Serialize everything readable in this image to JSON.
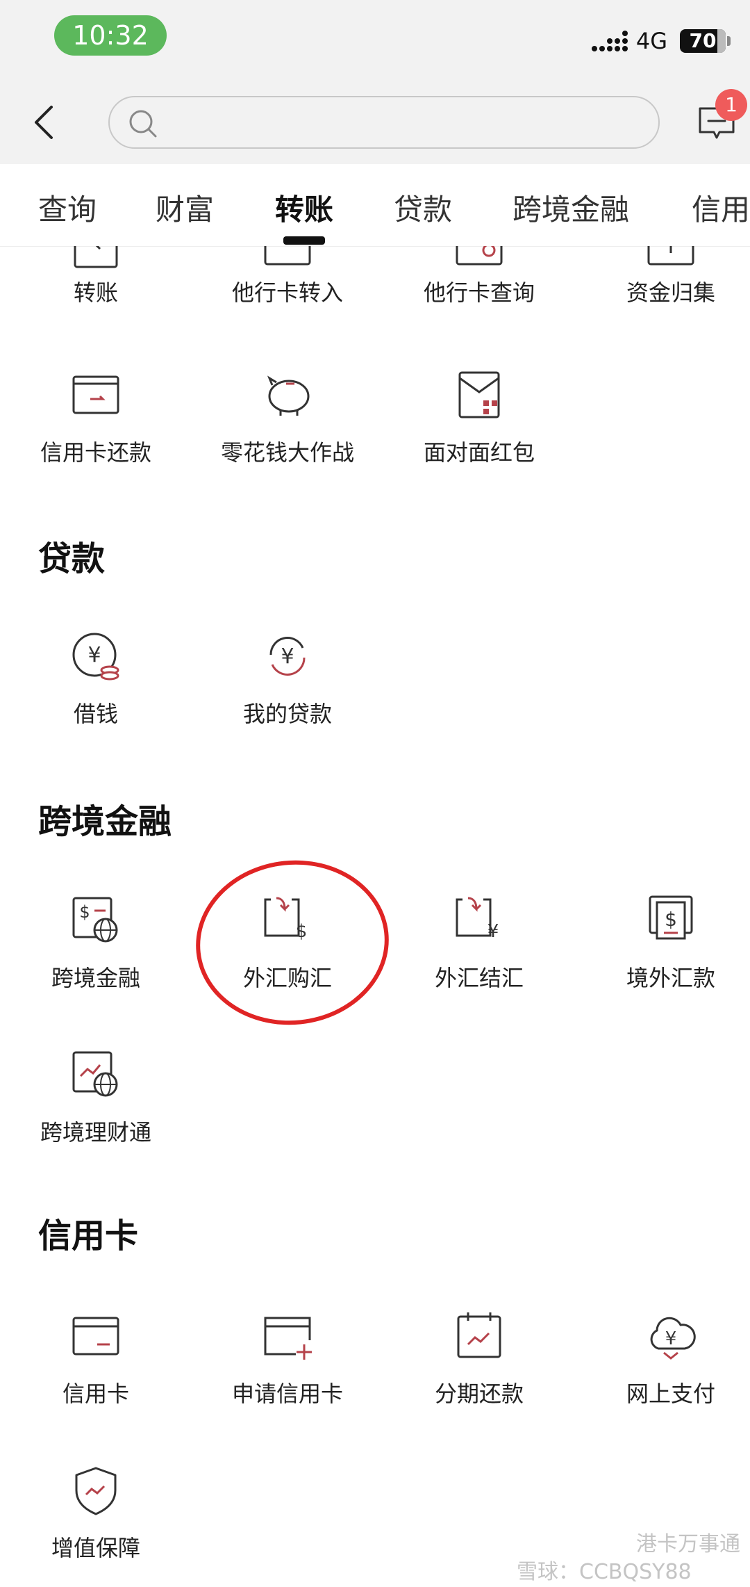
{
  "status_bar": {
    "time": "10:32",
    "network": "4G",
    "battery": "70"
  },
  "header": {
    "search_placeholder": "",
    "message_badge": "1"
  },
  "tabs": [
    "查询",
    "财富",
    "转账",
    "贷款",
    "跨境金融",
    "信用"
  ],
  "transfer": {
    "items": [
      "转账",
      "他行卡转入",
      "他行卡查询",
      "资金归集",
      "信用卡还款",
      "零花钱大作战",
      "面对面红包"
    ]
  },
  "loan": {
    "title": "贷款",
    "items": [
      "借钱",
      "我的贷款"
    ]
  },
  "crossborder": {
    "title": "跨境金融",
    "items": [
      "跨境金融",
      "外汇购汇",
      "外汇结汇",
      "境外汇款",
      "跨境理财通"
    ]
  },
  "credit": {
    "title": "信用卡",
    "items": [
      "信用卡",
      "申请信用卡",
      "分期还款",
      "网上支付",
      "增值保障"
    ]
  },
  "watermark": {
    "text": "雪球：CCBQSY88",
    "text2": "港卡万事通"
  },
  "colors": {
    "accent": "#b5424a",
    "annotation": "#e02424",
    "time_pill": "#5cb85c",
    "badge": "#ef5b5b"
  }
}
